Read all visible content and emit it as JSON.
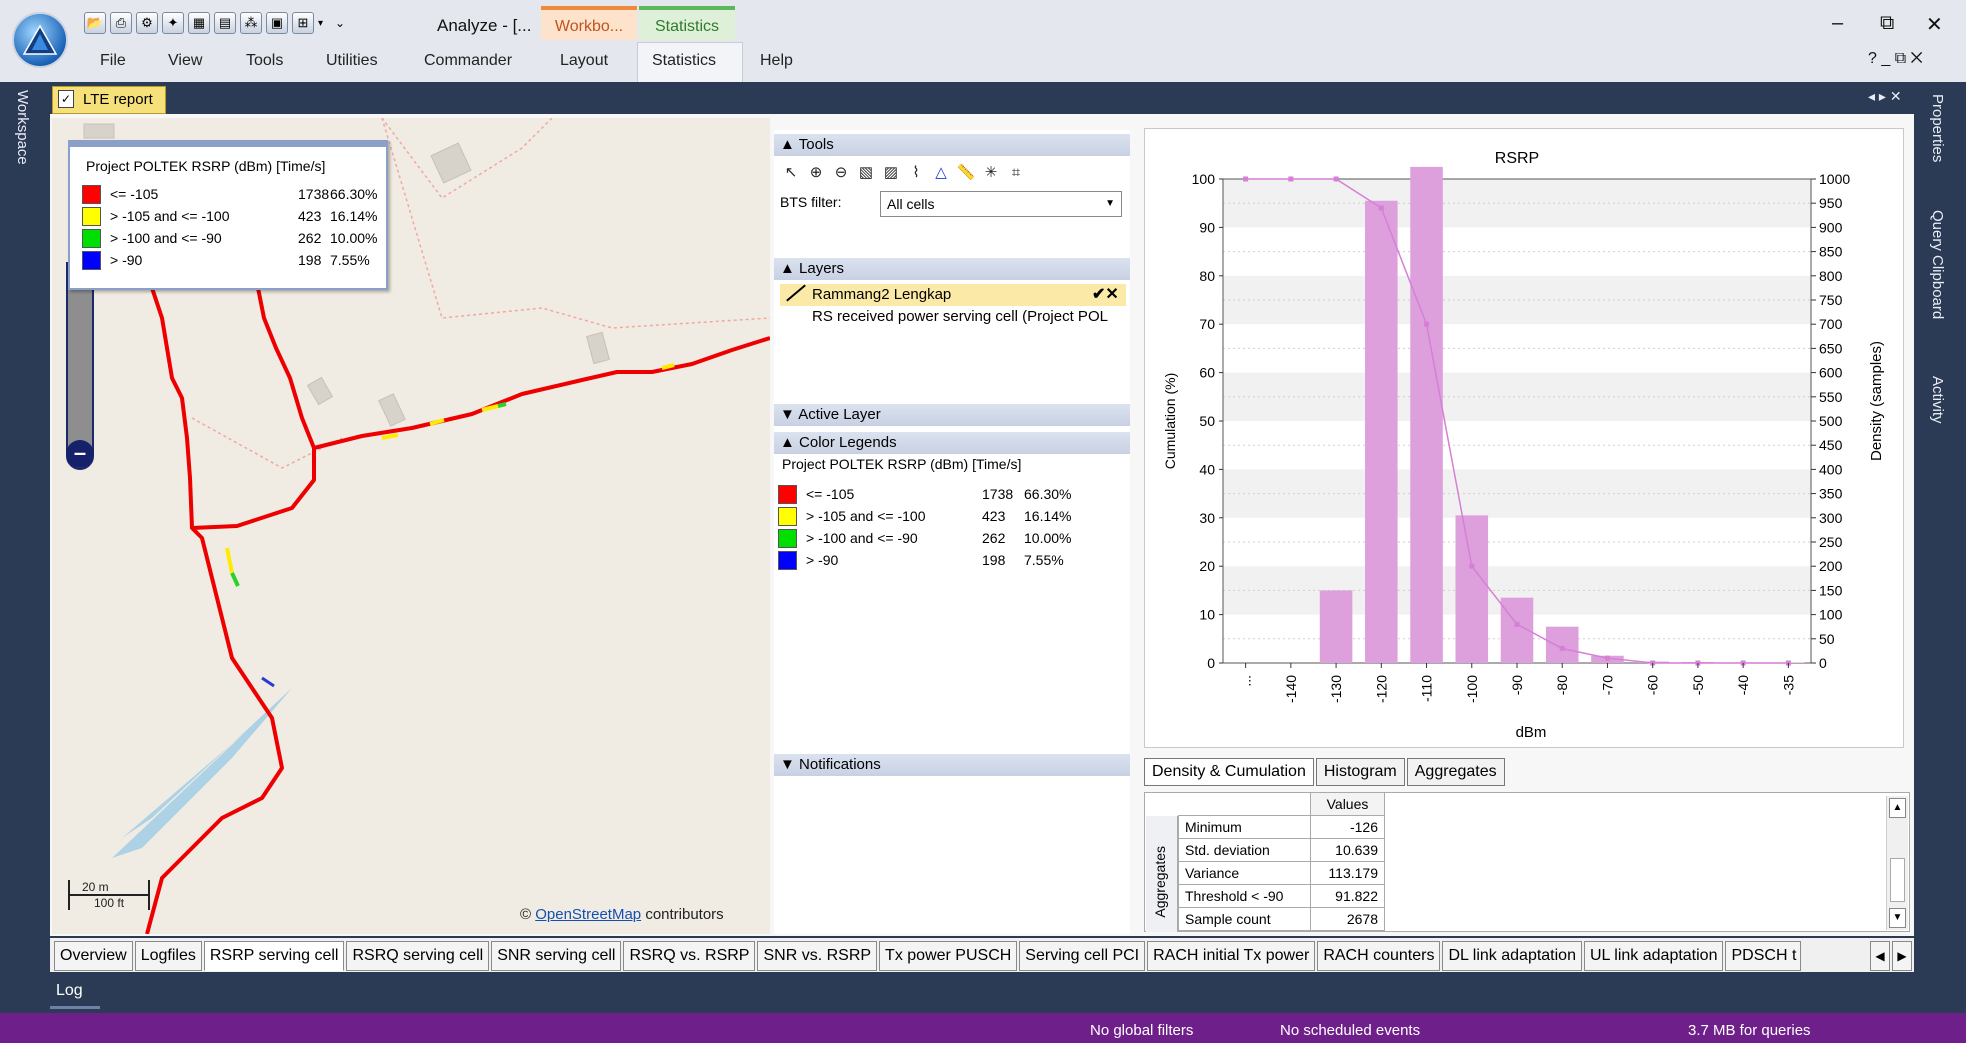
{
  "app": {
    "title": "Analyze - [...",
    "context_tabs": {
      "workbook": "Workbo...",
      "statistics": "Statistics"
    },
    "menu": [
      "File",
      "View",
      "Tools",
      "Utilities",
      "Commander",
      "Layout",
      "Statistics",
      "Help"
    ],
    "window_controls": {
      "minimize": "–",
      "restore": "⧉",
      "close": "✕"
    },
    "mdi_controls": "? _ ⧉ ✕"
  },
  "side": {
    "workspace": "Workspace",
    "right": [
      "Properties",
      "Query Clipboard",
      "Activity"
    ]
  },
  "document": {
    "tab": "LTE report",
    "controls": "◂ ▸ ✕"
  },
  "map": {
    "legend_title": "Project POLTEK RSRP (dBm) [Time/s]",
    "attribution_prefix": "©",
    "attribution_link": "OpenStreetMap",
    "attribution_suffix": "contributors",
    "scale_m": "20 m",
    "scale_ft": "100 ft"
  },
  "legend": [
    {
      "color": "#ff0000",
      "label": "<= -105",
      "count": "1738",
      "pct": "66.30%"
    },
    {
      "color": "#ffff00",
      "label": "> -105 and <= -100",
      "count": "423",
      "pct": "16.14%"
    },
    {
      "color": "#00e000",
      "label": "> -100 and <= -90",
      "count": "262",
      "pct": "10.00%"
    },
    {
      "color": "#0000ff",
      "label": "> -90",
      "count": "198",
      "pct": "7.55%"
    }
  ],
  "panel": {
    "tools": "Tools",
    "bts_label": "BTS filter:",
    "bts_value": "All cells",
    "layers": "Layers",
    "layer_name": "Rammang2 Lengkap",
    "layer_sub": "RS received power serving cell (Project POL",
    "active_layer": "Active Layer",
    "color_legends": "Color Legends",
    "color_legend_title": "Project POLTEK RSRP (dBm) [Time/s]",
    "notifications": "Notifications"
  },
  "chart_tabs": [
    "Density & Cumulation",
    "Histogram",
    "Aggregates"
  ],
  "chart_data": {
    "type": "bar",
    "title": "RSRP",
    "xlabel": "dBm",
    "ylabel_left": "Cumulation (%)",
    "ylabel_right": "Density (samples)",
    "categories": [
      "...",
      "-140",
      "-130",
      "-120",
      "-110",
      "-100",
      "-90",
      "-80",
      "-70",
      "-60",
      "-50",
      "-40",
      "-35"
    ],
    "series": [
      {
        "type": "bar",
        "axis": "right",
        "values": [
          0,
          0,
          150,
          955,
          1025,
          305,
          135,
          75,
          15,
          3,
          2,
          1,
          1
        ]
      },
      {
        "type": "line",
        "axis": "left",
        "values": [
          100,
          100,
          100,
          94,
          70,
          20,
          8,
          3,
          1,
          0,
          0,
          0,
          0
        ]
      }
    ],
    "ylim_left": [
      0,
      100
    ],
    "ylim_right": [
      0,
      1000
    ],
    "yticks_left": [
      "0",
      "10",
      "20",
      "30",
      "40",
      "50",
      "60",
      "70",
      "80",
      "90",
      "100"
    ],
    "yticks_right": [
      "0",
      "50",
      "100",
      "150",
      "200",
      "250",
      "300",
      "350",
      "400",
      "450",
      "500",
      "550",
      "600",
      "650",
      "700",
      "750",
      "800",
      "850",
      "900",
      "950",
      "1000"
    ],
    "colors": {
      "bar": "#dda0dd",
      "line": "#d67fd6"
    },
    "grid": true
  },
  "aggregates": {
    "side_label": "Aggregates",
    "header": "Values",
    "rows": [
      {
        "name": "Minimum",
        "value": "-126"
      },
      {
        "name": "Std. deviation",
        "value": "10.639"
      },
      {
        "name": "Variance",
        "value": "113.179"
      },
      {
        "name": "Threshold < -90",
        "value": "91.822"
      },
      {
        "name": "Sample count",
        "value": "2678"
      }
    ]
  },
  "bottom_tabs": [
    "Overview",
    "Logfiles",
    "RSRP serving cell",
    "RSRQ serving cell",
    "SNR serving cell",
    "RSRQ vs. RSRP",
    "SNR vs. RSRP",
    "Tx power PUSCH",
    "Serving cell PCI",
    "RACH initial Tx power",
    "RACH counters",
    "DL link adaptation",
    "UL link adaptation",
    "PDSCH t"
  ],
  "log": "Log",
  "status": {
    "filters": "No global filters",
    "events": "No scheduled events",
    "memory": "3.7 MB for queries"
  }
}
